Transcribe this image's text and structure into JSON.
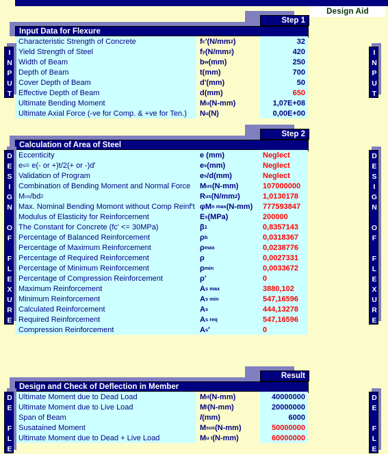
{
  "app": {
    "design_aid_label": "Design Aid"
  },
  "tabs": {
    "step1": "Step 1",
    "step2": "Step 2",
    "result": "Result"
  },
  "side_banners": {
    "left": [
      {
        "id": "input",
        "letters": [
          "I",
          "N",
          "P",
          "U",
          "T"
        ]
      },
      {
        "id": "design-of-flexure",
        "letters": [
          "D",
          "E",
          "S",
          "I",
          "G",
          "N",
          "",
          "O",
          "F",
          "",
          "F",
          "L",
          "E",
          "X",
          "U",
          "R",
          "E"
        ]
      },
      {
        "id": "deflection",
        "letters": [
          "D",
          "E",
          "",
          "F",
          "L",
          "E"
        ]
      }
    ],
    "right": [
      {
        "id": "input",
        "letters": [
          "I",
          "N",
          "P",
          "U",
          "T"
        ]
      },
      {
        "id": "design-of-flexure",
        "letters": [
          "D",
          "E",
          "S",
          "I",
          "G",
          "N",
          "",
          "O",
          "F",
          "",
          "F",
          "L",
          "E",
          "X",
          "U",
          "R",
          "E"
        ]
      },
      {
        "id": "deflection",
        "letters": [
          "D",
          "E",
          "",
          "F",
          "L",
          "E"
        ]
      }
    ]
  },
  "sections": [
    {
      "id": "input-data-for-flexure",
      "title": "Input Data for Flexure",
      "tab": "Step 1",
      "sym_bg": "cream",
      "value_align": "right",
      "rows": [
        {
          "label": "Characteristic Strength of Concrete",
          "symbol_html": "f<sub>c</sub>'(N/mm<sup>2</sup>)",
          "value": "32",
          "color": "black"
        },
        {
          "label": "Yield Strength of Steel",
          "symbol_html": "f<sub>y</sub>(N/mm<sup>2</sup>)",
          "value": "420",
          "color": "black"
        },
        {
          "label": "Width of Beam",
          "symbol_html": "b<sub>w</sub>(mm)",
          "value": "250",
          "color": "black"
        },
        {
          "label": "Depth of Beam",
          "symbol_html": "t(mm)",
          "value": "700",
          "color": "black"
        },
        {
          "label": "Cover Depth of Beam",
          "symbol_html": "d'(mm)",
          "value": "50",
          "color": "black"
        },
        {
          "label": "Effective Depth of Beam",
          "symbol_html": "d(mm)",
          "value": "650",
          "color": "red"
        },
        {
          "label": "Ultimate Bending Moment",
          "symbol_html": "M<sub>u</sub>(N-mm)",
          "value": "1,07E+08",
          "color": "black"
        },
        {
          "label": "Ultimate Axial Force (-ve for Comp. & +ve for Ten.)",
          "symbol_html": "N<sub>u</sub>(N)",
          "value": "0,00E+00",
          "color": "black"
        }
      ]
    },
    {
      "id": "calculation-of-area-of-steel",
      "title": "Calculation of Area of Steel",
      "tab": "Step 2",
      "sym_bg": "cyan",
      "value_align": "left",
      "rows": [
        {
          "label": "Eccenticity",
          "symbol_html": "e (mm)",
          "value": "Neglect",
          "color": "red"
        },
        {
          "label": "e<sub>s</sub> = e(- or +)t/2(+ or -)d'",
          "label_is_html": true,
          "symbol_html": "e<sub>s</sub> (mm)",
          "value": "Neglect",
          "color": "red"
        },
        {
          "label": "Validation of Program",
          "symbol_html": "e<sub>s</sub>/d(mm)",
          "value": "Neglect",
          "color": "red"
        },
        {
          "label": "Combination of Bending Moment and Normal Force",
          "symbol_html": "M<sub>us</sub> (N-mm)",
          "value": "107000000",
          "color": "red"
        },
        {
          "label": "M<sub>us</sub>/bd<sup>2</sup>",
          "label_is_html": true,
          "symbol_html": "R<sub>us</sub> (N/mm<sup>2</sup>)",
          "value": "1,0130178",
          "color": "red"
        },
        {
          "label": "Max. Nominal Bending Momont without Comp Reinf't",
          "symbol_html": "&phi;M<sub>n max</sub> (N-mm)",
          "value": "777593847",
          "color": "red"
        },
        {
          "label": "Modulus of Elasticity for Reinforcement",
          "symbol_html": "E<sub>s</sub> (MPa)",
          "value": "200000",
          "color": "red"
        },
        {
          "label": "The  Constant for Concrete (fc' <= 30MPa)",
          "symbol_html": "&beta;<sub>1</sub>",
          "value": "0,8357143",
          "color": "red"
        },
        {
          "label": "Percentage of Balanced Reinforcement",
          "symbol_html": "&rho;<sub>b</sub>",
          "value": "0,0318367",
          "color": "red"
        },
        {
          "label": "Percentage of Maximum Reinforcement",
          "symbol_html": "&rho;<sub>max</sub>",
          "value": "0,0238776",
          "color": "red"
        },
        {
          "label": "Percentage of Required Reinforcement",
          "symbol_html": "&rho;",
          "value": "0,0027331",
          "color": "red"
        },
        {
          "label": "Percentage of Minimum Reinforcement",
          "symbol_html": "&rho;<sub>min</sub>",
          "value": "0,0033672",
          "color": "red"
        },
        {
          "label": "Percentage of Compression Reinforcement",
          "symbol_html": "&rho;'",
          "value": "0",
          "color": "red"
        },
        {
          "label": "Maximum Reinforcement",
          "symbol_html": "A<sub>s max</sub>",
          "value": "3880,102",
          "color": "red"
        },
        {
          "label": "Minimum Reinforcement",
          "symbol_html": "A<sub>s min</sub>",
          "value": "547,16596",
          "color": "red"
        },
        {
          "label": "Calculated Reinforcement",
          "symbol_html": "A<sub>s</sub>",
          "value": "444,13278",
          "color": "red"
        },
        {
          "label": "Required Reinforcement",
          "symbol_html": "A<sub>s req</sub>",
          "value": "547,16596",
          "color": "red"
        },
        {
          "label": "Compression Reinforcement",
          "symbol_html": "A<sub>s</sub>'",
          "value": "0",
          "color": "red"
        }
      ]
    },
    {
      "id": "design-and-check-of-deflection-in-member",
      "title": "Design and Check of Deflection in Member",
      "tab": "Result",
      "sym_bg": "cream",
      "value_align": "right",
      "rows": [
        {
          "label": "Ultimate Moment due to Dead Load",
          "symbol_html": "M<sub>d</sub> (N-mm)",
          "value": "40000000",
          "color": "black"
        },
        {
          "label": "Ultimate Moment due to Live Load",
          "symbol_html": "M<sub>l</sub> (N-mm)",
          "value": "20000000",
          "color": "black"
        },
        {
          "label": "Span of Beam",
          "symbol_html": "<span class='ital'>l</span> (mm)",
          "value": "6000",
          "color": "black"
        },
        {
          "label": "Susatained Moment",
          "symbol_html": "M<sub>sus</sub> (N-mm)",
          "value": "50000000",
          "color": "red"
        },
        {
          "label": "Ultimate Moment due to Dead + Live Load",
          "symbol_html": "M<sub>u t</sub> (N-mm)",
          "value": "60000000",
          "color": "red"
        }
      ]
    }
  ],
  "colors": {
    "navy": "#000080",
    "shadow": "#8080C0",
    "cyan": "#CCFFFF",
    "cream": "#FCFCCA",
    "red": "#FF0000",
    "white": "#FFFFFF"
  }
}
